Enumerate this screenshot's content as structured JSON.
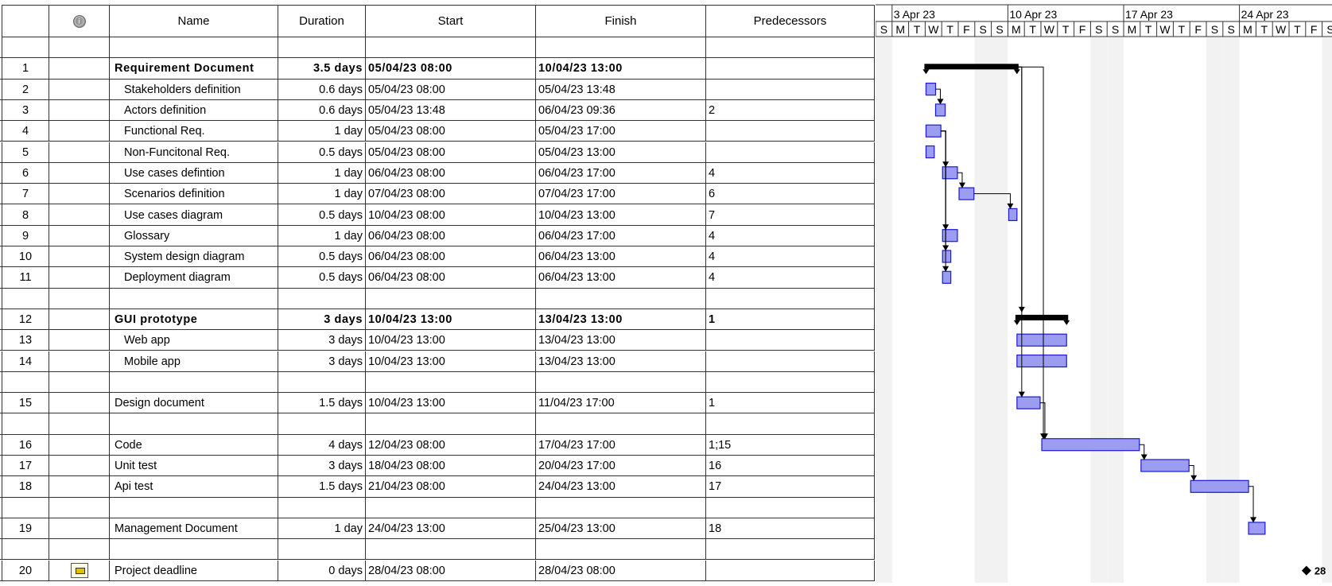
{
  "columns": {
    "indicator_icon": "info-icon",
    "name": "Name",
    "duration": "Duration",
    "start": "Start",
    "finish": "Finish",
    "predecessors": "Predecessors"
  },
  "timescale": {
    "weeks": [
      "3 Apr 23",
      "10 Apr 23",
      "17 Apr 23",
      "24 Apr 23"
    ],
    "days": [
      "S",
      "M",
      "T",
      "W",
      "T",
      "F",
      "S",
      "S",
      "M",
      "T",
      "W",
      "T",
      "F",
      "S",
      "S",
      "M",
      "T",
      "W",
      "T",
      "F",
      "S",
      "S",
      "M",
      "T",
      "W",
      "T",
      "F",
      "S"
    ]
  },
  "tasks": [
    {
      "id": "1",
      "name": "Requirement Document",
      "duration": "3.5 days",
      "start": "05/04/23 08:00",
      "finish": "10/04/23 13:00",
      "pred": "",
      "summary": true,
      "level": 0,
      "slot": 1
    },
    {
      "id": "2",
      "name": "Stakeholders definition",
      "duration": "0.6 days",
      "start": "05/04/23 08:00",
      "finish": "05/04/23 13:48",
      "pred": "",
      "summary": false,
      "level": 1,
      "slot": 2
    },
    {
      "id": "3",
      "name": "Actors definition",
      "duration": "0.6 days",
      "start": "05/04/23 13:48",
      "finish": "06/04/23 09:36",
      "pred": "2",
      "summary": false,
      "level": 1,
      "slot": 3
    },
    {
      "id": "4",
      "name": "Functional Req.",
      "duration": "1 day",
      "start": "05/04/23 08:00",
      "finish": "05/04/23 17:00",
      "pred": "",
      "summary": false,
      "level": 1,
      "slot": 4
    },
    {
      "id": "5",
      "name": "Non-Funcitonal Req.",
      "duration": "0.5 days",
      "start": "05/04/23 08:00",
      "finish": "05/04/23 13:00",
      "pred": "",
      "summary": false,
      "level": 1,
      "slot": 5
    },
    {
      "id": "6",
      "name": "Use cases defintion",
      "duration": "1 day",
      "start": "06/04/23 08:00",
      "finish": "06/04/23 17:00",
      "pred": "4",
      "summary": false,
      "level": 1,
      "slot": 6
    },
    {
      "id": "7",
      "name": "Scenarios definition",
      "duration": "1 day",
      "start": "07/04/23 08:00",
      "finish": "07/04/23 17:00",
      "pred": "6",
      "summary": false,
      "level": 1,
      "slot": 7
    },
    {
      "id": "8",
      "name": "Use cases diagram",
      "duration": "0.5 days",
      "start": "10/04/23 08:00",
      "finish": "10/04/23 13:00",
      "pred": "7",
      "summary": false,
      "level": 1,
      "slot": 8
    },
    {
      "id": "9",
      "name": "Glossary",
      "duration": "1 day",
      "start": "06/04/23 08:00",
      "finish": "06/04/23 17:00",
      "pred": "4",
      "summary": false,
      "level": 1,
      "slot": 9
    },
    {
      "id": "10",
      "name": "System design diagram",
      "duration": "0.5 days",
      "start": "06/04/23 08:00",
      "finish": "06/04/23 13:00",
      "pred": "4",
      "summary": false,
      "level": 1,
      "slot": 10
    },
    {
      "id": "11",
      "name": "Deployment diagram",
      "duration": "0.5 days",
      "start": "06/04/23 08:00",
      "finish": "06/04/23 13:00",
      "pred": "4",
      "summary": false,
      "level": 1,
      "slot": 11
    },
    {
      "id": "12",
      "name": "GUI prototype",
      "duration": "3 days",
      "start": "10/04/23 13:00",
      "finish": "13/04/23 13:00",
      "pred": "1",
      "summary": true,
      "level": 0,
      "slot": 13
    },
    {
      "id": "13",
      "name": "Web app",
      "duration": "3 days",
      "start": "10/04/23 13:00",
      "finish": "13/04/23 13:00",
      "pred": "",
      "summary": false,
      "level": 1,
      "slot": 14
    },
    {
      "id": "14",
      "name": "Mobile app",
      "duration": "3 days",
      "start": "10/04/23 13:00",
      "finish": "13/04/23 13:00",
      "pred": "",
      "summary": false,
      "level": 1,
      "slot": 15
    },
    {
      "id": "15",
      "name": "Design document",
      "duration": "1.5 days",
      "start": "10/04/23 13:00",
      "finish": "11/04/23 17:00",
      "pred": "1",
      "summary": false,
      "level": 0,
      "slot": 17
    },
    {
      "id": "16",
      "name": "Code",
      "duration": "4 days",
      "start": "12/04/23 08:00",
      "finish": "17/04/23 17:00",
      "pred": "1;15",
      "summary": false,
      "level": 0,
      "slot": 19
    },
    {
      "id": "17",
      "name": "Unit test",
      "duration": "3 days",
      "start": "18/04/23 08:00",
      "finish": "20/04/23 17:00",
      "pred": "16",
      "summary": false,
      "level": 0,
      "slot": 20
    },
    {
      "id": "18",
      "name": "Api test",
      "duration": "1.5 days",
      "start": "21/04/23 08:00",
      "finish": "24/04/23 13:00",
      "pred": "17",
      "summary": false,
      "level": 0,
      "slot": 21
    },
    {
      "id": "19",
      "name": "Management Document",
      "duration": "1 day",
      "start": "24/04/23 13:00",
      "finish": "25/04/23 13:00",
      "pred": "18",
      "summary": false,
      "level": 0,
      "slot": 23
    },
    {
      "id": "20",
      "name": "Project deadline",
      "duration": "0 days",
      "start": "28/04/23 08:00",
      "finish": "28/04/23 08:00",
      "pred": "",
      "summary": false,
      "level": 0,
      "slot": 25,
      "milestone": true,
      "icon": "calendar-icon"
    }
  ],
  "milestone_label": "28",
  "colors": {
    "bar_fill": "#9c9cf0",
    "bar_stroke": "#1a1ad6",
    "summary": "#000000",
    "weekend": "#f2f2f2"
  }
}
